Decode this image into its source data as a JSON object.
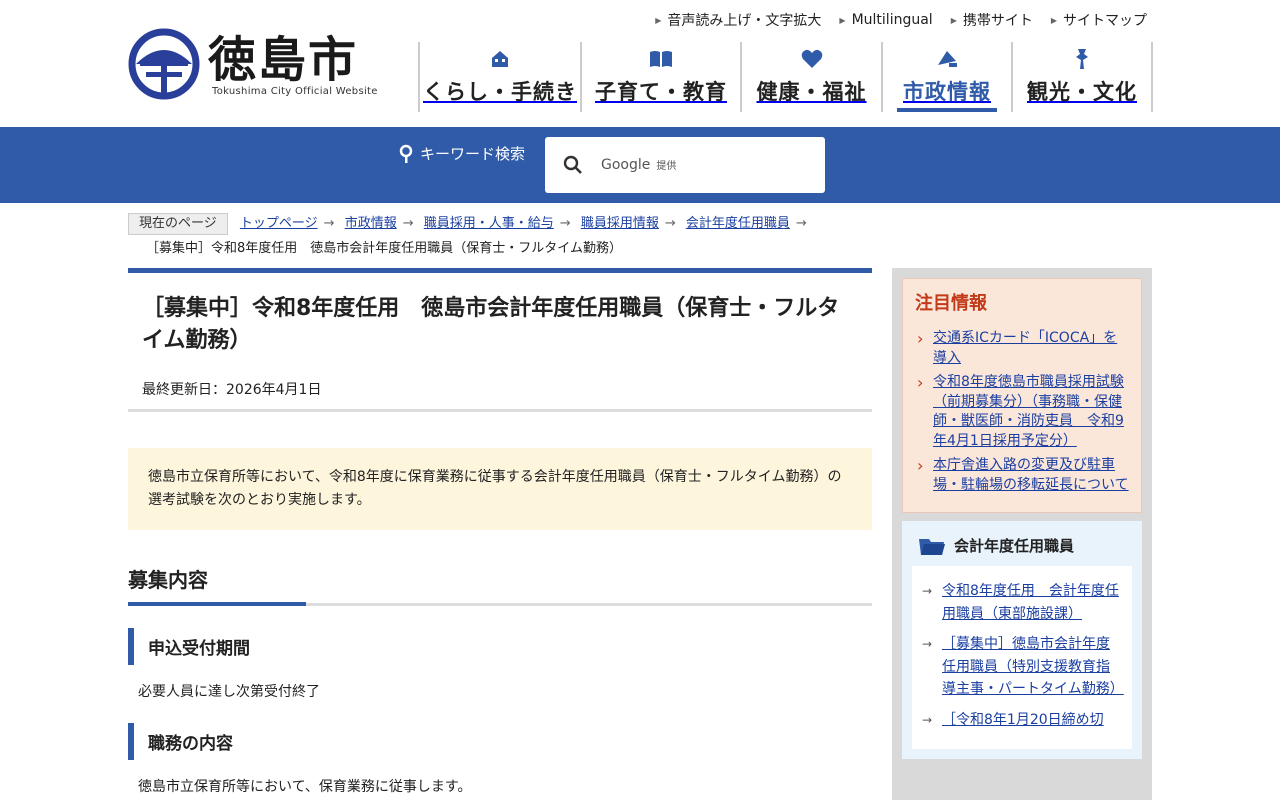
{
  "utility_links": [
    "音声読み上げ・文字拡大",
    "Multilingual",
    "携帯サイト",
    "サイトマップ"
  ],
  "logo": {
    "name": "徳島市",
    "sub": "Tokushima City Official Website"
  },
  "gnav": [
    {
      "label": "くらし・手続き",
      "icon": "house-icon"
    },
    {
      "label": "子育て・教育",
      "icon": "book-icon"
    },
    {
      "label": "健康・福祉",
      "icon": "heart-icon"
    },
    {
      "label": "市政情報",
      "icon": "megaphone-icon",
      "active": true
    },
    {
      "label": "観光・文化",
      "icon": "map-pin-icon"
    }
  ],
  "search": {
    "label": "キーワード検索",
    "google": "Google",
    "provided": "提供"
  },
  "breadcrumb": {
    "current_label": "現在のページ",
    "items": [
      "トップページ",
      "市政情報",
      "職員採用・人事・給与",
      "職員採用情報",
      "会計年度任用職員"
    ],
    "last": "［募集中］令和8年度任用　徳島市会計年度任用職員（保育士・フルタイム勤務）"
  },
  "page": {
    "title": "［募集中］令和8年度任用　徳島市会計年度任用職員（保育士・フルタイム勤務）",
    "updated": "最終更新日：2026年4月1日",
    "lead": "徳島市立保育所等において、令和8年度に保育業務に従事する会計年度任用職員（保育士・フルタイム勤務）の選考試験を次のとおり実施します。",
    "h2": "募集内容",
    "sections": [
      {
        "heading": "申込受付期間",
        "text": "必要人員に達し次第受付終了"
      },
      {
        "heading": "職務の内容",
        "text": "徳島市立保育所等において、保育業務に従事します。"
      }
    ]
  },
  "sidebar": {
    "notice_title": "注目情報",
    "notices": [
      "交通系ICカード「ICOCA」を導入",
      "令和8年度徳島市職員採用試験（前期募集分）（事務職・保健師・獣医師・消防吏員　令和9年4月1日採用予定分）",
      "本庁舎進入路の変更及び駐車場・駐輪場の移転延長について"
    ],
    "related_title": "会計年度任用職員",
    "related": [
      "令和8年度任用　会計年度任用職員（東部施設課）",
      "［募集中］徳島市会計年度任用職員（特別支援教育指導主事・パートタイム勤務）",
      "［令和8年1月20日締め切"
    ]
  },
  "colors": {
    "brand": "#2f5ba8",
    "notice_title": "#c23a18",
    "link": "#1a3fa0"
  }
}
